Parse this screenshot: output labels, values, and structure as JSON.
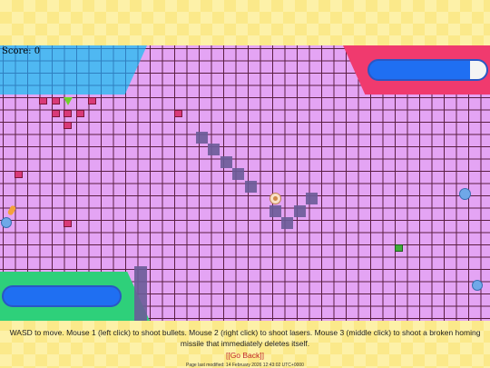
{
  "hud": {
    "score_text": "Score: 0"
  },
  "footer": {
    "instructions": "WASD to move. Mouse 1 (left click) to shoot bullets. Mouse 2 (right click) to shoot lasers. Mouse 3 (middle click) to shoot a broken homing missile that immediately deletes itself.",
    "go_back": "[[Go Back]]",
    "last_modified": "Page last modified: 14 February 2026 12:43:02 UTC+0000"
  },
  "colors": {
    "arena": "#e4a4f4",
    "zone_blue": "#4fb8f2",
    "zone_red": "#f03a6e",
    "zone_green": "#2ed07a",
    "pill": "#1f6ff2",
    "crate": "#d93a78"
  }
}
